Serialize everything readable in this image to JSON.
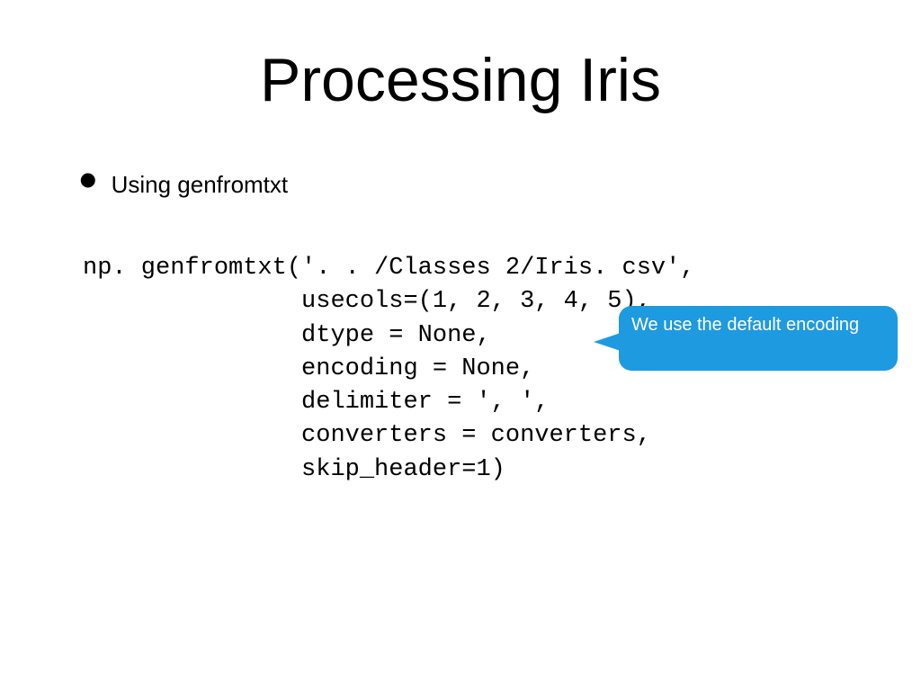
{
  "title": "Processing Iris",
  "bullet": {
    "text": "Using genfromtxt"
  },
  "code": {
    "line1": "np. genfromtxt('. . /Classes 2/Iris. csv',",
    "line2": "               usecols=(1, 2, 3, 4, 5),",
    "line3": "               dtype = None,",
    "line4": "               encoding = None,",
    "line5": "               delimiter = ', ',",
    "line6": "               converters = converters,",
    "line7": "               skip_header=1)"
  },
  "callout": {
    "text": "We use the default encoding"
  }
}
